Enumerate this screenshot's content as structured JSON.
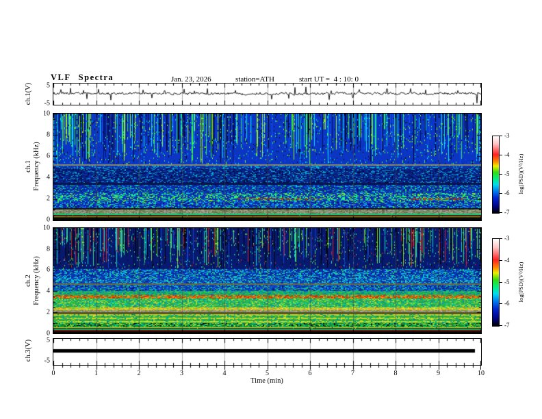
{
  "header": {
    "title": "VLF Spectra",
    "date": "Jan. 23, 2026",
    "station": "station=ATH",
    "start_ut": "start UT =  4 : 10: 0"
  },
  "left_axis": {
    "ch1_wave_label": "ch.1(V)",
    "spec1_label_channel": "ch.1",
    "spec2_label_channel": "ch.2",
    "spec_freq_label": "Frequency (kHz)",
    "ch3_wave_label": "ch.3(V)",
    "wave_ticks": [
      "5",
      "-5"
    ],
    "spec_ticks": [
      "10",
      "8",
      "6",
      "4",
      "2",
      "0"
    ]
  },
  "x_axis": {
    "label": "Time (min)",
    "ticks": [
      "0",
      "1",
      "2",
      "3",
      "4",
      "5",
      "6",
      "7",
      "8",
      "9",
      "10"
    ]
  },
  "colorbar": {
    "label": "log(PSD)(V²/Hz)",
    "ticks": [
      "-3",
      "-4",
      "-5",
      "-6",
      "-7"
    ],
    "gradient": [
      "#ffffff 0%",
      "#ffc4c4 10%",
      "#ff2222 24%",
      "#ff8800 33%",
      "#eeee00 39%",
      "#33dd11 47%",
      "#00ee88 56%",
      "#00ddee 63%",
      "#0077ee 72%",
      "#0022cc 81%",
      "#000488 91%",
      "#000000 100%"
    ]
  },
  "chart_data": [
    {
      "type": "line",
      "title": "ch.1 voltage waveform",
      "ylabel": "ch.1(V)",
      "xlabel": "Time (min)",
      "xlim": [
        0,
        10
      ],
      "ylim": [
        -5,
        5
      ],
      "baseline_v": 0.3,
      "noise_v": 0.7,
      "spikes": [
        [
          0.18,
          2.2
        ],
        [
          0.4,
          2.8
        ],
        [
          0.7,
          1.8
        ],
        [
          0.78,
          -2.2
        ],
        [
          1.05,
          2.3
        ],
        [
          1.35,
          -2.8
        ],
        [
          2.1,
          2.0
        ],
        [
          2.3,
          -1.8
        ],
        [
          2.6,
          1.6
        ],
        [
          3.05,
          2.4
        ],
        [
          3.3,
          1.5
        ],
        [
          3.6,
          2.6
        ],
        [
          4.25,
          1.8
        ],
        [
          5.1,
          -2.4
        ],
        [
          5.5,
          -2.0
        ],
        [
          5.65,
          3.2
        ],
        [
          5.9,
          3.4
        ],
        [
          6.45,
          -2.6
        ],
        [
          6.5,
          1.6
        ],
        [
          7.0,
          -1.6
        ],
        [
          7.15,
          2.2
        ],
        [
          7.8,
          2.5
        ],
        [
          8.35,
          2.6
        ],
        [
          8.7,
          2.0
        ],
        [
          9.45,
          1.7
        ],
        [
          9.9,
          -4.2
        ]
      ]
    },
    {
      "type": "heatmap",
      "title": "ch.1 VLF spectrogram",
      "ylabel": "Frequency (kHz)",
      "xlabel": "Time (min)",
      "xlim": [
        0,
        10
      ],
      "ylim": [
        0,
        10
      ],
      "colorbar_range": [
        -7,
        -3
      ],
      "bands": [
        {
          "f": [
            0,
            0.26
          ],
          "style": "solid",
          "colors": [
            "#060606"
          ]
        },
        {
          "f": [
            0.26,
            0.34
          ],
          "style": "solid",
          "colors": [
            "#701512"
          ]
        },
        {
          "f": [
            0.34,
            0.64
          ],
          "style": "stripes",
          "bg": "#0a0a0a",
          "colors": [
            "#22cc33",
            "#00ddcc",
            "#101010",
            "#bb2200",
            "#33aa22"
          ]
        },
        {
          "f": [
            0.64,
            1.02
          ],
          "style": "speckle",
          "bg": "#8f9070",
          "colors": [
            "#a8a890",
            "#77785a",
            "#9a9aaa",
            "#559944",
            "#666644"
          ],
          "density": 0.8
        },
        {
          "f": [
            1.02,
            1.14
          ],
          "style": "solid",
          "colors": [
            "#15150f"
          ]
        },
        {
          "f": [
            1.14,
            1.78
          ],
          "style": "speckle",
          "bg": "#0a2fae",
          "colors": [
            "#00ccee",
            "#2255ee",
            "#001080",
            "#33dd55"
          ],
          "density": 0.5
        },
        {
          "f": [
            1.78,
            2.55
          ],
          "style": "speckle",
          "bg": "#0c38c0",
          "colors": [
            "#22dd66",
            "#00eebb",
            "#77ee33",
            "#0a1f90"
          ],
          "density": 0.55
        },
        {
          "f": [
            2.55,
            3.35
          ],
          "style": "speckle",
          "bg": "#0a2da8",
          "colors": [
            "#00bbee",
            "#1144cc",
            "#001878",
            "#22cc66"
          ],
          "density": 0.45
        },
        {
          "f": [
            3.35,
            3.5
          ],
          "style": "solid",
          "colors": [
            "#0a1450"
          ]
        },
        {
          "f": [
            3.5,
            4.85
          ],
          "style": "speckle",
          "bg": "#07207e",
          "colors": [
            "#0a35b0",
            "#000c46",
            "#0aa0cc"
          ],
          "density": 0.5
        },
        {
          "f": [
            4.85,
            5.12
          ],
          "style": "speckle",
          "bg": "#0a2da0",
          "colors": [
            "#00bbcc",
            "#123ecc"
          ],
          "density": 0.4
        },
        {
          "f": [
            5.12,
            5.28
          ],
          "style": "solid",
          "colors": [
            "#8a8a66"
          ]
        },
        {
          "f": [
            5.28,
            10
          ],
          "style": "vstreaks",
          "bg": "#0b36c4",
          "p_dark": 0.14,
          "p_bright": 0.22,
          "colors": [
            "#05081a",
            "#001064",
            "#00ddee",
            "#33ee44",
            "#99ee22",
            "#1150ee"
          ]
        }
      ],
      "overlays": [
        {
          "f": [
            1.95,
            2.12
          ],
          "x": [
            4.3,
            6.2
          ],
          "colors": [
            "#993311",
            "#bb4411"
          ],
          "density": 0.5
        },
        {
          "f": [
            1.95,
            2.12
          ],
          "x": [
            8.35,
            9.65
          ],
          "colors": [
            "#993311",
            "#bb4411"
          ],
          "density": 0.5
        }
      ]
    },
    {
      "type": "heatmap",
      "title": "ch.2 VLF spectrogram",
      "ylabel": "Frequency (kHz)",
      "xlabel": "Time (min)",
      "xlim": [
        0,
        10
      ],
      "ylim": [
        0,
        10
      ],
      "colorbar_range": [
        -7,
        -3
      ],
      "bands": [
        {
          "f": [
            0,
            0.18
          ],
          "style": "solid",
          "colors": [
            "#060606"
          ]
        },
        {
          "f": [
            0.18,
            0.3
          ],
          "style": "solid",
          "colors": [
            "#701010"
          ]
        },
        {
          "f": [
            0.3,
            0.62
          ],
          "style": "stripes",
          "bg": "#0a0a0a",
          "colors": [
            "#22bb33",
            "#ddcc00",
            "#121212",
            "#00ccbb",
            "#33aa22"
          ]
        },
        {
          "f": [
            0.62,
            0.95
          ],
          "style": "speckle",
          "bg": "#118833",
          "colors": [
            "#33cc44",
            "#00bbaa",
            "#0a0a0a",
            "#bbdd22"
          ],
          "density": 0.5
        },
        {
          "f": [
            0.95,
            1.85
          ],
          "style": "hstripes",
          "bg": "#2fae3e",
          "stripe": "#c8d822",
          "colors": [
            "#55cc33",
            "#00bb99",
            "#dddd33",
            "#118877"
          ],
          "density": 0.35
        },
        {
          "f": [
            1.85,
            2.0
          ],
          "style": "solid",
          "colors": [
            "#555522"
          ]
        },
        {
          "f": [
            2.0,
            2.18
          ],
          "style": "speckle",
          "bg": "#999977",
          "colors": [
            "#aaaaaa",
            "#888855",
            "#778866"
          ],
          "density": 0.8
        },
        {
          "f": [
            2.18,
            2.45
          ],
          "style": "speckle",
          "bg": "#cccc22",
          "colors": [
            "#eedd33",
            "#ee8811",
            "#66cc33"
          ],
          "density": 0.6
        },
        {
          "f": [
            2.45,
            3.3
          ],
          "style": "speckle",
          "bg": "#2db045",
          "colors": [
            "#55dd44",
            "#00ccaa",
            "#bbdd33",
            "#118899"
          ],
          "density": 0.55
        },
        {
          "f": [
            3.3,
            3.62
          ],
          "style": "speckle",
          "bg": "#33aa44",
          "colors": [
            "#dd2200",
            "#ff7700",
            "#cc4400",
            "#ee9933"
          ],
          "density": 0.7
        },
        {
          "f": [
            3.62,
            4.0
          ],
          "style": "speckle",
          "bg": "#22aa55",
          "colors": [
            "#00bb99",
            "#44cc44",
            "#0a70b0"
          ],
          "density": 0.5
        },
        {
          "f": [
            4.0,
            4.58
          ],
          "style": "speckle",
          "bg": "#0a40c0",
          "colors": [
            "#00bbdd",
            "#2255dd",
            "#001c70",
            "#22bb66"
          ],
          "density": 0.55
        },
        {
          "f": [
            4.58,
            4.72
          ],
          "style": "solid",
          "colors": [
            "#6a6a44"
          ]
        },
        {
          "f": [
            4.72,
            5.3
          ],
          "style": "speckle",
          "bg": "#0a45c0",
          "colors": [
            "#00ccdd",
            "#33ccaa",
            "#0a2585"
          ],
          "density": 0.5
        },
        {
          "f": [
            5.3,
            6.1
          ],
          "style": "speckle",
          "bg": "#0a35b5",
          "colors": [
            "#00bbee",
            "#0a1c80",
            "#22cc88"
          ],
          "density": 0.5
        },
        {
          "f": [
            6.1,
            10
          ],
          "style": "vstreaks",
          "bg": "#071a70",
          "p_dark": 0.2,
          "p_bright": 0.22,
          "colors": [
            "#03040f",
            "#000a40",
            "#00ddcc",
            "#33dd66",
            "#1140cc",
            "#77dd33",
            "#cc2222"
          ]
        }
      ],
      "overlays": []
    },
    {
      "type": "line",
      "title": "ch.3 voltage waveform (flat saturated trace)",
      "ylabel": "ch.3(V)",
      "xlabel": "Time (min)",
      "xlim": [
        0,
        10
      ],
      "ylim": [
        -5,
        5
      ],
      "value_v": 0.5,
      "thickness_v": 1.3,
      "x_end_min": 9.85
    }
  ]
}
